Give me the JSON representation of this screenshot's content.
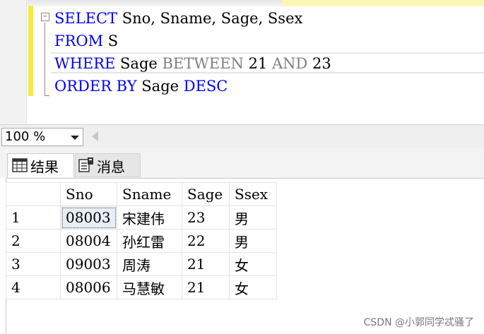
{
  "editor": {
    "lines": [
      {
        "parts": [
          {
            "t": "SELECT",
            "c": "kw"
          },
          {
            "t": " Sno,",
            "c": ""
          },
          {
            "t": " Sname,",
            "c": ""
          },
          {
            "t": " Sage,",
            "c": ""
          },
          {
            "t": " Ssex",
            "c": ""
          }
        ]
      },
      {
        "parts": [
          {
            "t": "FROM",
            "c": "kw"
          },
          {
            "t": " S",
            "c": ""
          }
        ]
      },
      {
        "parts": [
          {
            "t": "WHERE",
            "c": "kw"
          },
          {
            "t": " Sage ",
            "c": ""
          },
          {
            "t": "BETWEEN",
            "c": "op"
          },
          {
            "t": " 21 ",
            "c": ""
          },
          {
            "t": "AND",
            "c": "op"
          },
          {
            "t": " 23",
            "c": ""
          }
        ]
      },
      {
        "parts": [
          {
            "t": "ORDER BY",
            "c": "kw"
          },
          {
            "t": " Sage ",
            "c": ""
          },
          {
            "t": "DESC",
            "c": "kw"
          }
        ]
      }
    ],
    "collapse_glyph": "−"
  },
  "zoom": {
    "value": "100 %"
  },
  "tabs": {
    "results": "结果",
    "messages": "消息"
  },
  "grid": {
    "columns": [
      "",
      "Sno",
      "Sname",
      "Sage",
      "Ssex"
    ],
    "rows": [
      [
        "1",
        "08003",
        "宋建伟",
        "23",
        "男"
      ],
      [
        "2",
        "08004",
        "孙红雷",
        "22",
        "男"
      ],
      [
        "3",
        "09003",
        "周涛",
        "21",
        "女"
      ],
      [
        "4",
        "08006",
        "马慧敏",
        "21",
        "女"
      ]
    ]
  },
  "watermark": "CSDN @小郭同学忒骚了",
  "colors": {
    "keyword": "#0000ff",
    "operator": "#808080",
    "change_bar": "#f5e94a"
  }
}
